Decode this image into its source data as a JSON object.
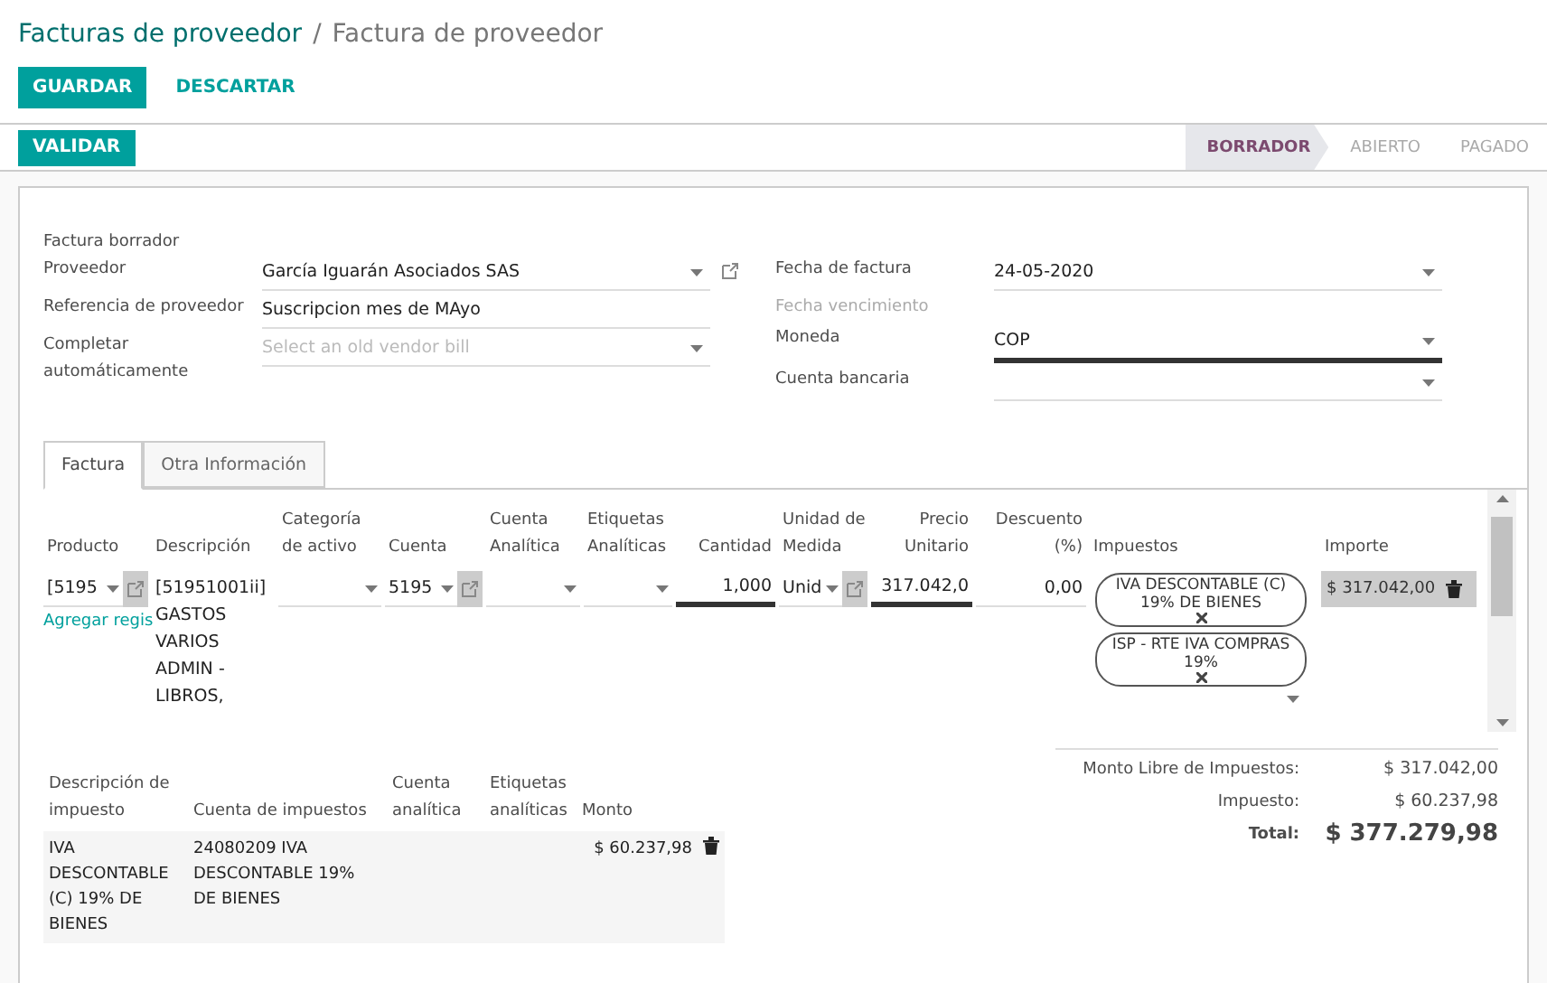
{
  "breadcrumb": {
    "parent": "Facturas de proveedor",
    "separator": "/",
    "current": "Factura de proveedor"
  },
  "actions": [
    {
      "label": "GUARDAR",
      "kind": "primary"
    },
    {
      "label": "DESCARTAR",
      "kind": "link"
    }
  ],
  "status_bar": {
    "button": "VALIDAR",
    "stages": [
      {
        "label": "BORRADOR",
        "selected": true
      },
      {
        "label": "ABIERTO",
        "selected": false
      },
      {
        "label": "PAGADO",
        "selected": false
      }
    ]
  },
  "form": {
    "title": "Factura borrador",
    "left_fields": [
      {
        "label": "Proveedor",
        "value": "García Iguarán Asociados SAS",
        "kind": "select",
        "link": true,
        "focused": false
      },
      {
        "label": "Referencia de proveedor",
        "value": "Suscripcion mes de MAyo",
        "kind": "text",
        "link": false,
        "focused": false
      },
      {
        "label": "Completar automáticamente",
        "placeholder": "Select an old vendor bill",
        "kind": "select",
        "link": false,
        "focused": false
      }
    ],
    "right_fields": [
      {
        "label": "Fecha de factura",
        "value": "24-05-2020",
        "kind": "select",
        "focused": false
      },
      {
        "label": "Fecha vencimiento",
        "kind": "readonly"
      },
      {
        "label": "Moneda",
        "value": "COP",
        "kind": "select",
        "focused": true
      },
      {
        "label": "Cuenta bancaria",
        "kind": "select",
        "focused": false
      }
    ]
  },
  "tabs": [
    {
      "label": "Factura",
      "selected": true
    },
    {
      "label": "Otra Información",
      "selected": false
    }
  ],
  "lines": {
    "columns": [
      "Producto",
      "Descripción",
      "Categoría de activo",
      "Cuenta",
      "Cuenta Analítica",
      "Etiquetas Analíticas",
      "Cantidad",
      "Unidad de Medida",
      "Precio Unitario",
      "Descuento (%)",
      "Impuestos",
      "Importe"
    ],
    "add_link": "Agregar regis",
    "rows": [
      {
        "cells": [
          {
            "kind": "select",
            "value": "[5195",
            "link": true,
            "focused": false
          },
          {
            "kind": "text",
            "value": "[51951001ii] GASTOS VARIOS ADMIN - LIBROS,"
          },
          {
            "kind": "select",
            "link": false,
            "focused": false
          },
          {
            "kind": "select",
            "value": "5195",
            "link": true,
            "focused": false
          },
          {
            "kind": "select",
            "link": false,
            "focused": false
          },
          {
            "kind": "select",
            "link": false,
            "focused": false
          },
          {
            "kind": "number",
            "value": "1,000",
            "link": false,
            "focused": true
          },
          {
            "kind": "select",
            "value": "Unid",
            "link": true,
            "focused": false
          },
          {
            "kind": "number",
            "value": "317.042,0",
            "link": false,
            "focused": true
          },
          {
            "kind": "number",
            "value": "0,00",
            "link": false,
            "focused": false
          },
          {
            "kind": "tags",
            "tags": [
              "IVA DESCONTABLE (C) 19% DE BIENES",
              "ISP - RTE IVA COMPRAS 19%"
            ]
          },
          {
            "kind": "amount",
            "value": "$ 317.042,00"
          }
        ]
      }
    ]
  },
  "tax_lines": {
    "columns": [
      "Descripción de impuesto",
      "Cuenta de impuestos",
      "Cuenta analítica",
      "Etiquetas analíticas",
      "Monto"
    ],
    "rows": [
      {
        "description": "IVA DESCONTABLE (C) 19% DE BIENES",
        "account": "24080209 IVA DESCONTABLE 19% DE BIENES",
        "amount": "$ 60.237,98"
      }
    ]
  },
  "totals": [
    {
      "label": "Monto Libre de Impuestos:",
      "value": "$ 317.042,00",
      "kind": "subtotal"
    },
    {
      "label": "Impuesto:",
      "value": "$ 60.237,98",
      "kind": "subtotal"
    },
    {
      "label": "Total:",
      "value": "$ 377.279,98",
      "kind": "total"
    }
  ]
}
